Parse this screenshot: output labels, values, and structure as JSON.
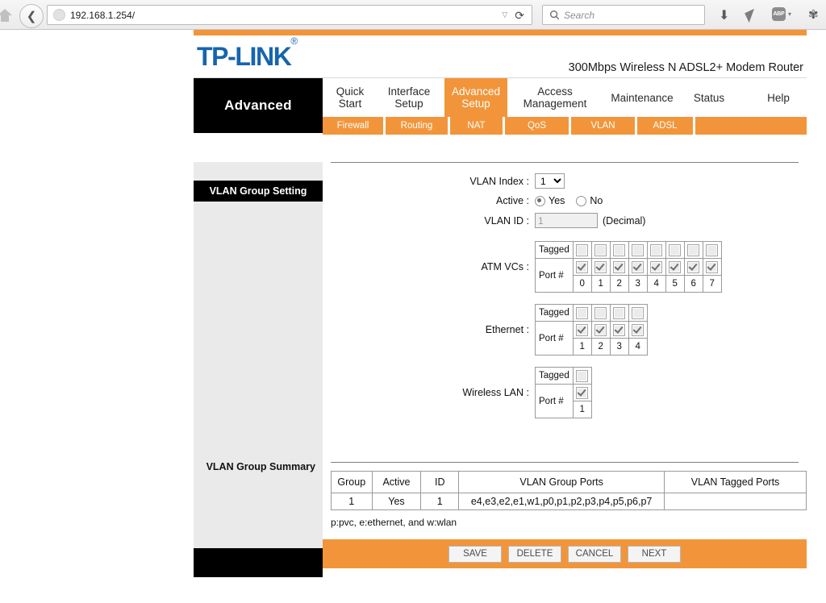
{
  "browser": {
    "url": "192.168.1.254/",
    "search_placeholder": "Search",
    "reload_glyph": "⟳",
    "dropdown_glyph": "▽",
    "back_glyph": "❮",
    "icons": {
      "download": "⬇",
      "send": "◤",
      "abp": "ABP",
      "abp_caret": "▾",
      "bee": "✾"
    }
  },
  "header": {
    "brand": "TP-LINK",
    "brand_mark": "®",
    "model": "300Mbps Wireless N ADSL2+ Modem Router"
  },
  "nav": {
    "section_label": "Advanced",
    "tabs": [
      {
        "line1": "Quick",
        "line2": "Start",
        "active": false
      },
      {
        "line1": "Interface",
        "line2": "Setup",
        "active": false
      },
      {
        "line1": "Advanced",
        "line2": "Setup",
        "active": true
      },
      {
        "line1": "Access",
        "line2": "Management",
        "active": false
      },
      {
        "line1": "Maintenance",
        "line2": "",
        "active": false
      },
      {
        "line1": "Status",
        "line2": "",
        "active": false
      },
      {
        "line1": "Help",
        "line2": "",
        "active": false
      }
    ],
    "subtabs": [
      {
        "label": "Firewall"
      },
      {
        "label": "Routing"
      },
      {
        "label": "NAT"
      },
      {
        "label": "QoS"
      },
      {
        "label": "VLAN"
      },
      {
        "label": "ADSL"
      }
    ]
  },
  "sidebar": {
    "group_setting_title": "VLAN Group Setting",
    "group_summary_title": "VLAN Group Summary"
  },
  "form": {
    "vlan_index_label": "VLAN Index :",
    "vlan_index_value": "1",
    "vlan_index_options": [
      "1"
    ],
    "active_label": "Active :",
    "active_yes": "Yes",
    "active_no": "No",
    "active_selected": "Yes",
    "vlan_id_label": "VLAN ID :",
    "vlan_id_value": "1",
    "vlan_id_hint": "(Decimal)",
    "tagged_label": "Tagged",
    "port_label": "Port #",
    "groups": [
      {
        "label": "ATM VCs :",
        "ports": [
          "0",
          "1",
          "2",
          "3",
          "4",
          "5",
          "6",
          "7"
        ],
        "tagged": [
          false,
          false,
          false,
          false,
          false,
          false,
          false,
          false
        ],
        "member": [
          true,
          true,
          true,
          true,
          true,
          true,
          true,
          true
        ]
      },
      {
        "label": "Ethernet :",
        "ports": [
          "1",
          "2",
          "3",
          "4"
        ],
        "tagged": [
          false,
          false,
          false,
          false
        ],
        "member": [
          true,
          true,
          true,
          true
        ]
      },
      {
        "label": "Wireless LAN :",
        "ports": [
          "1"
        ],
        "tagged": [
          false
        ],
        "member": [
          true
        ]
      }
    ]
  },
  "summary": {
    "columns": [
      "Group",
      "Active",
      "ID",
      "VLAN Group Ports",
      "VLAN Tagged Ports"
    ],
    "rows": [
      [
        "1",
        "Yes",
        "1",
        "e4,e3,e2,e1,w1,p0,p1,p2,p3,p4,p5,p6,p7",
        ""
      ]
    ],
    "legend": "p:pvc, e:ethernet, and w:wlan"
  },
  "buttons": [
    {
      "label": "SAVE"
    },
    {
      "label": "DELETE"
    },
    {
      "label": "CANCEL"
    },
    {
      "label": "NEXT"
    }
  ],
  "colors": {
    "orange": "#f2953a",
    "brand_blue": "#1565ae",
    "sidebar_gray": "#eaeaea"
  }
}
